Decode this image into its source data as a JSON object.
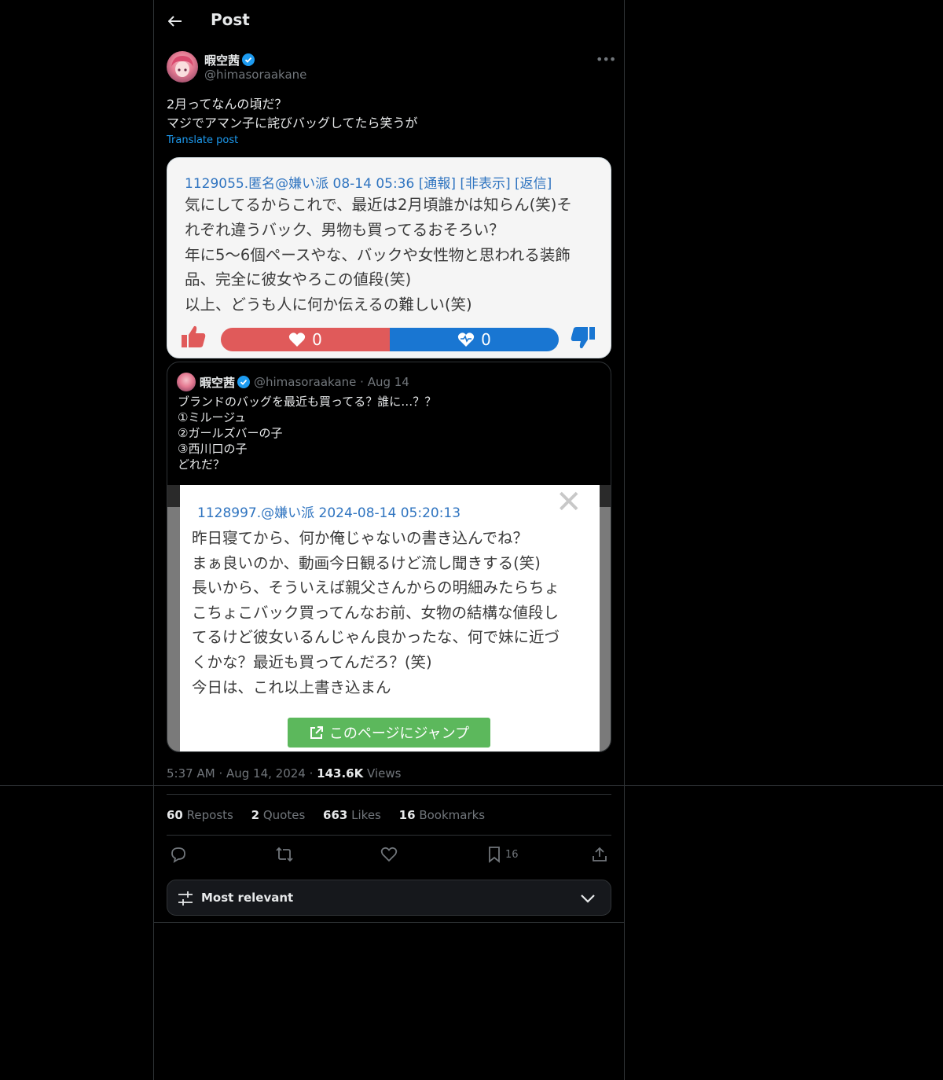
{
  "header": {
    "title": "Post"
  },
  "author": {
    "name": "暇空茜",
    "handle": "@himasoraakane"
  },
  "tweet": {
    "text": "2月ってなんの頃だ？\nマジでアマン子に詫びバッグしてたら笑うが",
    "translate_label": "Translate post"
  },
  "image1": {
    "header": "1129055.匿名@嫌い派 08-14 05:36 [通報] [非表示] [返信]",
    "lines": [
      "気にしてるからこれで、最近は2月頃誰かは知らん(笑)そ",
      "れぞれ違うバック、男物も買ってるおそろい？",
      "年に5〜6個ペースやな、バックや女性物と思われる装飾",
      "品、完全に彼女やろこの値段(笑)",
      "以上、どうも人に何か伝えるの難しい(笑)"
    ],
    "like_count": "0",
    "dislike_count": "0"
  },
  "quote": {
    "name": "暇空茜",
    "handle": "@himasoraakane",
    "date": "Aug 14",
    "text": "ブランドのバッグを最近も買ってる？誰に…？？\n①ミルージュ\n②ガールズバーの子\n③西川口の子\nどれだ？",
    "image": {
      "header": "1128997.@嫌い派 2024-08-14 05:20:13",
      "lines": [
        "昨日寝てから、何か俺じゃないの書き込んでね？",
        "まぁ良いのか、動画今日観るけど流し聞きする(笑)",
        "長いから、そういえば親父さんからの明細みたらちょ",
        "こちょこバック買ってんなお前、女物の結構な値段し",
        "てるけど彼女いるんじゃん良かったな、何で妹に近づ",
        "くかな？最近も買ってんだろ？(笑)",
        "今日は、これ以上書き込まん"
      ],
      "jump_label": "このページにジャンプ"
    }
  },
  "meta": {
    "time": "5:37 AM",
    "date": "Aug 14, 2024",
    "views_count": "143.6K",
    "views_label": "Views"
  },
  "stats": {
    "reposts_count": "60",
    "reposts_label": "Reposts",
    "quotes_count": "2",
    "quotes_label": "Quotes",
    "likes_count": "663",
    "likes_label": "Likes",
    "bookmarks_count": "16",
    "bookmarks_label": "Bookmarks"
  },
  "actions": {
    "reply_icon": "reply-icon",
    "repost_icon": "repost-icon",
    "like_icon": "heart-icon",
    "bookmark_icon": "bookmark-icon",
    "bookmark_count": "16",
    "share_icon": "share-icon"
  },
  "sort": {
    "label": "Most relevant"
  },
  "colors": {
    "accent": "#1d9bf0",
    "muted": "#71767b",
    "border": "#2f3336",
    "like_bar": "#e05a5a",
    "dislike_bar": "#1976d2",
    "jump_button": "#5cb85c"
  }
}
